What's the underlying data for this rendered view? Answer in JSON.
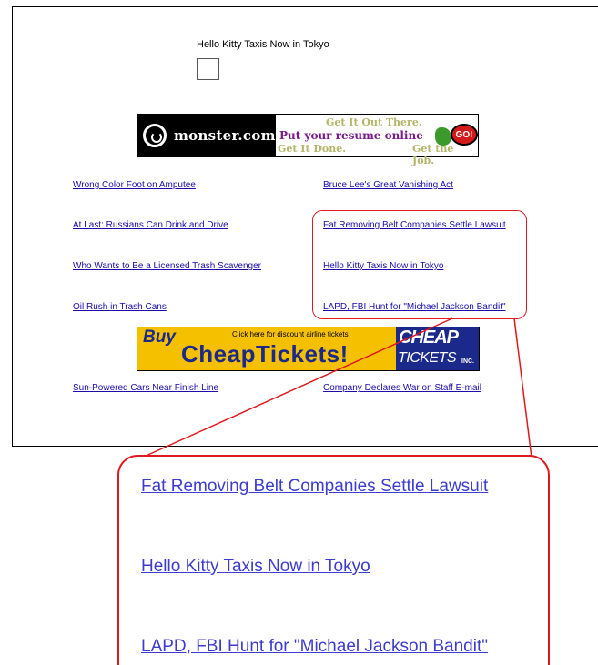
{
  "page": {
    "title": "Hello Kitty Taxis Now in Tokyo"
  },
  "monster_ad": {
    "brand": "monster.com",
    "line1": "Get It Out There.",
    "line2": "Put your resume online",
    "line3": "Get It Done.",
    "line4": "Get the Job.",
    "go_label": "GO!"
  },
  "links": {
    "left": [
      "Wrong Color Foot on Amputee",
      "At Last: Russians Can Drink and Drive",
      "Who Wants to Be a Licensed Trash Scavenger",
      "Oil Rush in Trash Cans",
      "Sun-Powered Cars Near Finish Line"
    ],
    "right": [
      "Bruce Lee's Great Vanishing Act",
      "Fat Removing Belt Companies Settle Lawsuit",
      "Hello Kitty Taxis Now in Tokyo",
      "LAPD, FBI Hunt for \"Michael Jackson Bandit\"",
      "Company Declares War on Staff E-mail"
    ]
  },
  "cheaptickets_ad": {
    "tagline": "Click here for discount airline tickets",
    "buy": "Buy",
    "main": "CheapTickets!",
    "logo_line1": "CHEAP",
    "logo_line2": "TICKETS",
    "logo_suffix": "INC."
  },
  "zoom": {
    "links": [
      "Fat Removing Belt Companies Settle Lawsuit",
      "Hello Kitty Taxis Now in Tokyo",
      "LAPD, FBI Hunt for \"Michael Jackson Bandit\""
    ]
  },
  "colors": {
    "link": "#1a0dab",
    "callout": "#e0191f",
    "ad_yellow": "#f5c000",
    "ad_blue": "#1b2a8a"
  }
}
